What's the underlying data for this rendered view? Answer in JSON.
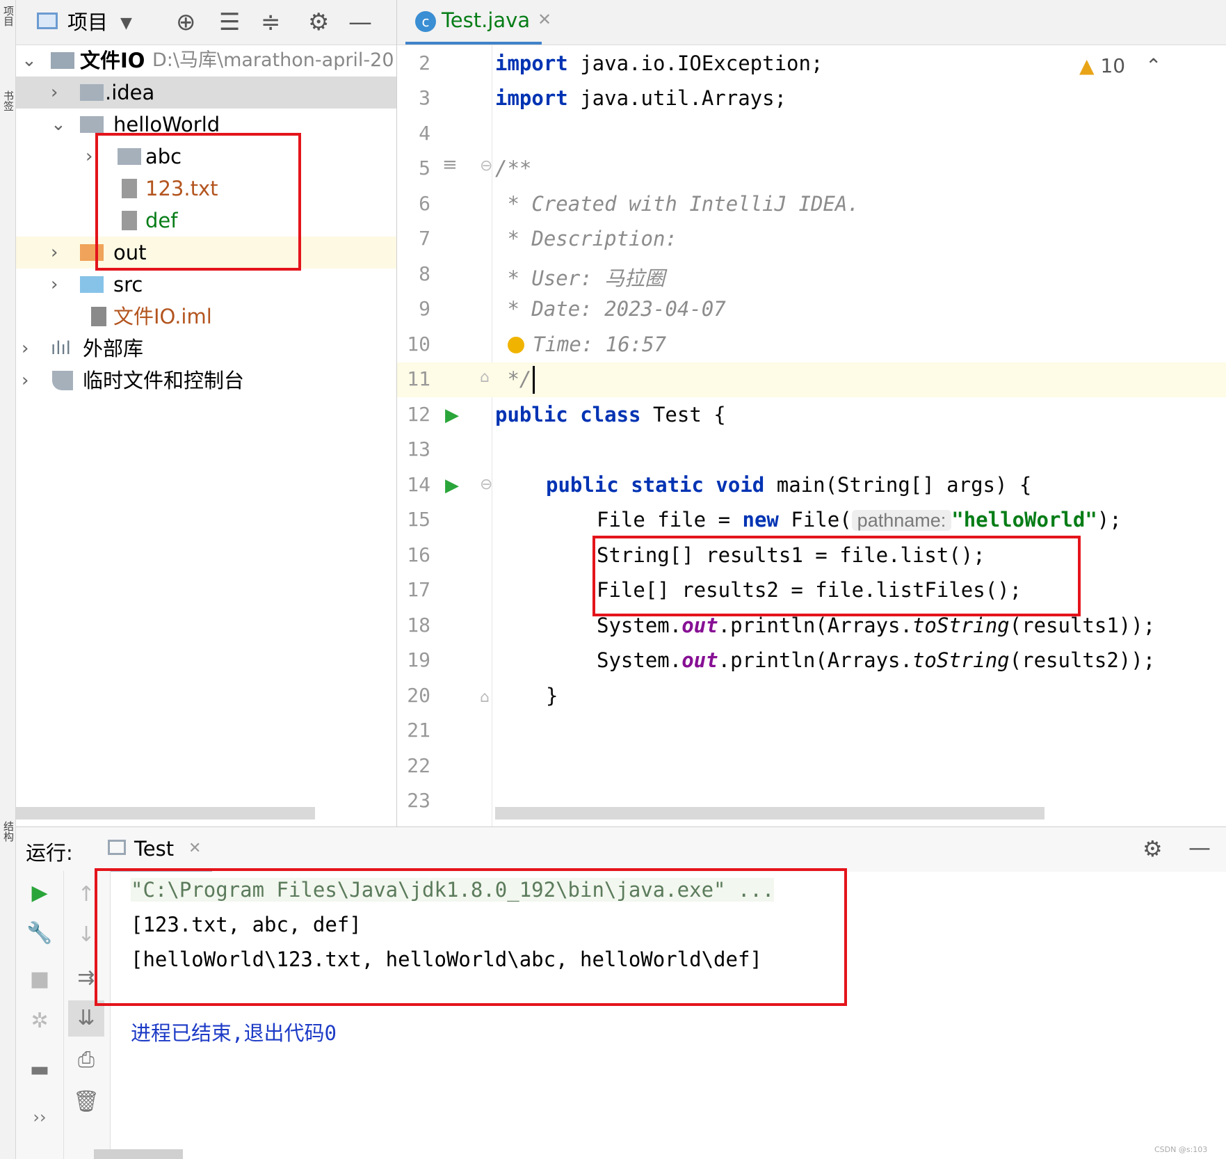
{
  "left_stripe": {
    "tab_project": "项目",
    "tab_bookmarks": "书签",
    "tab_structure": "结构"
  },
  "project_panel": {
    "title": "项目",
    "tree": [
      {
        "name": "文件IO",
        "path": "D:\\马库\\marathon-april-20",
        "expanded": true
      },
      {
        "name": ".idea"
      },
      {
        "name": "helloWorld",
        "expanded": true
      },
      {
        "name": "abc"
      },
      {
        "name": "123.txt"
      },
      {
        "name": "def"
      },
      {
        "name": "out"
      },
      {
        "name": "src"
      },
      {
        "name": "文件IO.iml"
      },
      {
        "name": "外部库"
      },
      {
        "name": "临时文件和控制台"
      }
    ]
  },
  "editor": {
    "tab": "Test.java",
    "warnings_count": "10",
    "line_numbers": [
      "2",
      "3",
      "4",
      "5",
      "6",
      "7",
      "8",
      "9",
      "10",
      "11",
      "12",
      "13",
      "14",
      "15",
      "16",
      "17",
      "18",
      "19",
      "20",
      "21",
      "22",
      "23"
    ],
    "code": {
      "l2_kw": "import",
      "l2_rest": " java.io.IOException;",
      "l3_kw": "import",
      "l3_rest": " java.util.Arrays;",
      "l5": "/**",
      "l6": " * Created with IntelliJ IDEA.",
      "l7": " * Description:",
      "l8": " * User: 马拉圈",
      "l9": " * Date: 2023-04-07",
      "l10": "Time: 16:57",
      "l11": " */",
      "l12_kw": "public class",
      "l12_rest": " Test {",
      "l14_kw": "public static void",
      "l14_rest": " main(String[] args) {",
      "l15_a": "File file = ",
      "l15_kw": "new",
      "l15_b": " File(",
      "l15_hint": "pathname:",
      "l15_str": "\"helloWorld\"",
      "l15_c": ");",
      "l16": "String[] results1 = file.list();",
      "l17": "File[] results2 = file.listFiles();",
      "l18_a": "System.",
      "l18_f": "out",
      "l18_b": ".println(Arrays.",
      "l18_i": "toString",
      "l18_c": "(results1));",
      "l19_a": "System.",
      "l19_f": "out",
      "l19_b": ".println(Arrays.",
      "l19_i": "toString",
      "l19_c": "(results2));",
      "l20": "}"
    }
  },
  "run_panel": {
    "label": "运行:",
    "tab": "Test",
    "output": [
      "\"C:\\Program Files\\Java\\jdk1.8.0_192\\bin\\java.exe\" ...",
      "[123.txt, abc, def]",
      "[helloWorld\\123.txt, helloWorld\\abc, helloWorld\\def]",
      "进程已结束,退出代码0"
    ],
    "more": "››"
  },
  "watermark": "CSDN @s:103",
  "colors": {
    "keyword": "#0033b3",
    "comment": "#8c8c8c",
    "string": "#067d17",
    "field": "#871094",
    "highlight_box": "#e4141b",
    "caret_line": "#fefbe6"
  }
}
